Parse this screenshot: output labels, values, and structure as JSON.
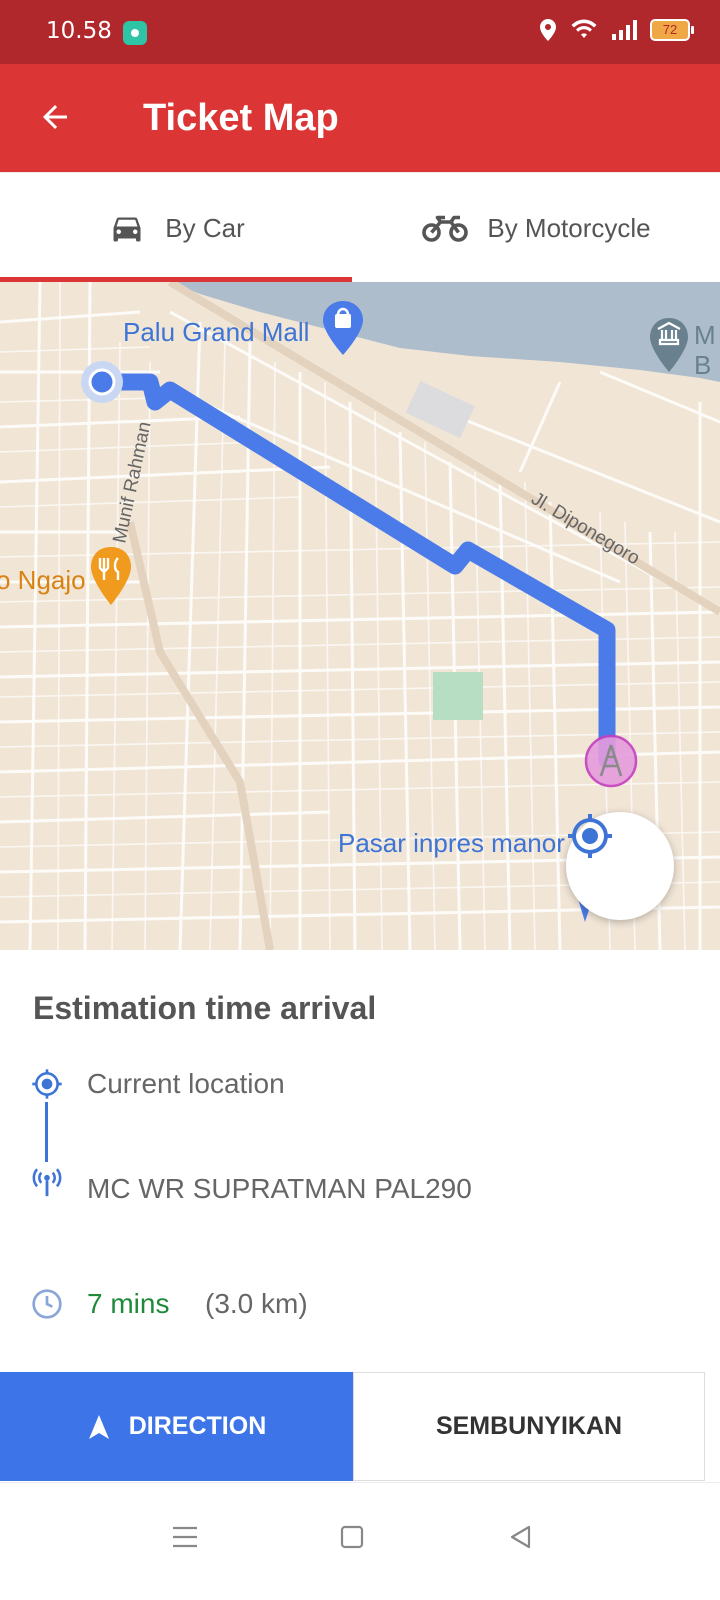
{
  "status_bar": {
    "time": "10.58",
    "battery": "72"
  },
  "app_bar": {
    "title": "Ticket Map"
  },
  "tabs": [
    {
      "label": "By Car",
      "icon": "car-icon",
      "selected": true
    },
    {
      "label": "By Motorcycle",
      "icon": "motorcycle-icon",
      "selected": false
    }
  ],
  "map": {
    "places": [
      {
        "label": "Palu Grand Mall",
        "icon": "shopping-pin-icon"
      },
      {
        "label": "o Ngajo",
        "icon": "restaurant-pin-icon"
      },
      {
        "label": "Pasar inpres manor",
        "icon": "market-pin-icon"
      },
      {
        "label": "M",
        "icon": "museum-pin-icon"
      },
      {
        "label": "B",
        "icon": ""
      }
    ],
    "streets": [
      "Munif Rahman",
      "Jl. Diponegoro"
    ],
    "route_color": "#4a7be8"
  },
  "panel": {
    "title": "Estimation time arrival",
    "origin": "Current location",
    "destination": "MC WR SUPRATMAN PAL290",
    "eta_time": "7 mins",
    "eta_distance": "(3.0 km)"
  },
  "buttons": {
    "direction": "DIRECTION",
    "hide": "SEMBUNYIKAN"
  },
  "colors": {
    "accent": "#dc3535",
    "status_bar": "#b0282c",
    "primary_blue": "#3d74e8",
    "eta_green": "#1e8a3a"
  }
}
